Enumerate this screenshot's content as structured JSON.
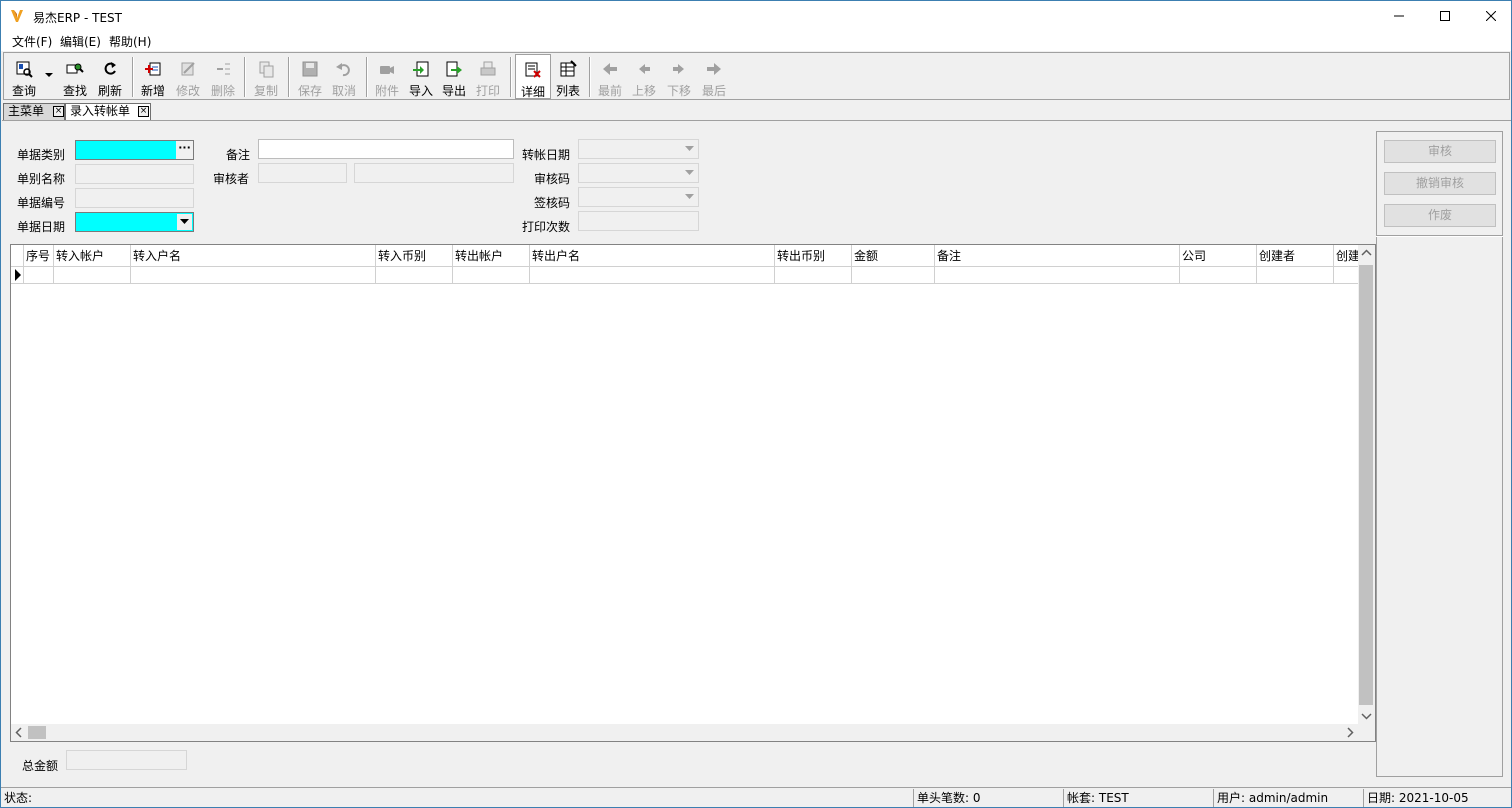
{
  "window": {
    "title": "易杰ERP - TEST"
  },
  "menu": [
    "文件(F)",
    "编辑(E)",
    "帮助(H)"
  ],
  "toolbar": {
    "query": "查询",
    "find": "查找",
    "refresh": "刷新",
    "add": "新增",
    "modify": "修改",
    "delete": "删除",
    "copy": "复制",
    "save": "保存",
    "cancel": "取消",
    "attach": "附件",
    "import": "导入",
    "export": "导出",
    "print": "打印",
    "detail": "详细",
    "list": "列表",
    "first": "最前",
    "up": "上移",
    "down": "下移",
    "last": "最后"
  },
  "tabs": [
    {
      "label": "主菜单"
    },
    {
      "label": "录入转帐单"
    }
  ],
  "form": {
    "doc_type_label": "单据类别",
    "doc_name_label": "单别名称",
    "doc_no_label": "单据编号",
    "doc_date_label": "单据日期",
    "remark_label": "备注",
    "reviewer_label": "审核者",
    "transfer_date_label": "转帐日期",
    "review_code_label": "审核码",
    "sign_code_label": "签核码",
    "print_count_label": "打印次数"
  },
  "side_buttons": {
    "approve": "审核",
    "unapprove": "撤销审核",
    "void": "作废"
  },
  "grid": {
    "columns": [
      "序号",
      "转入帐户",
      "转入户名",
      "转入币别",
      "转出帐户",
      "转出户名",
      "转出币别",
      "金额",
      "备注",
      "公司",
      "创建者",
      "创建"
    ]
  },
  "footer": {
    "total_label": "总金额"
  },
  "status": {
    "state": "状态:",
    "header_count": "单头笔数: 0",
    "account_set": "帐套: TEST",
    "user": "用户: admin/admin",
    "date": "日期: 2021-10-05"
  }
}
